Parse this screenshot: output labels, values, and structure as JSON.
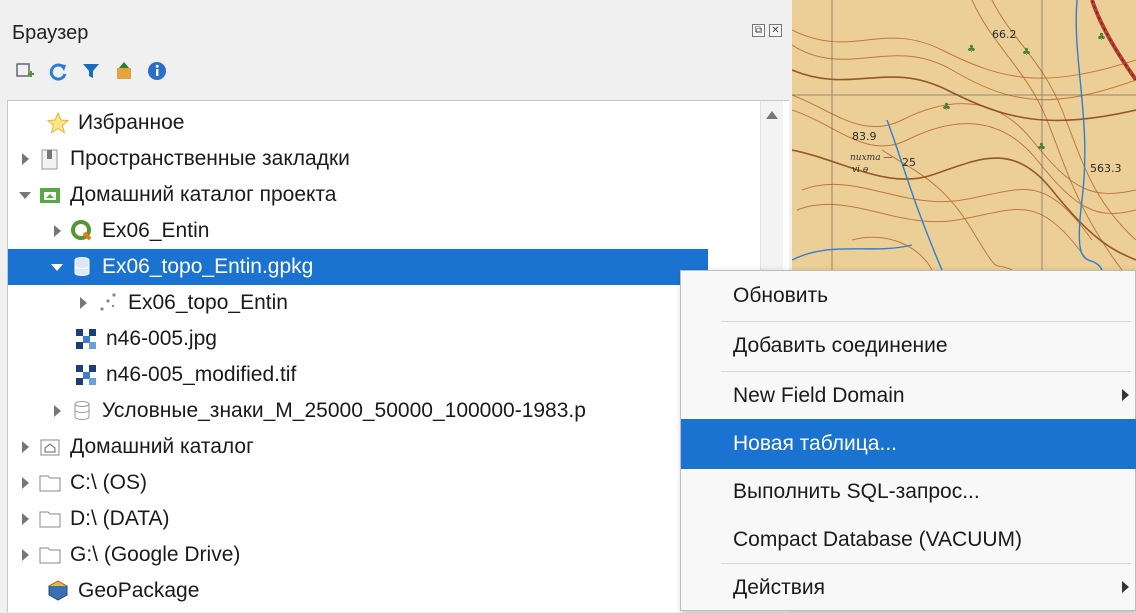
{
  "panel": {
    "title": "Браузер",
    "controls": [
      "⧉",
      "✕"
    ]
  },
  "tree": {
    "items": [
      {
        "label": "Избранное",
        "icon": "star-icon",
        "expander": "none"
      },
      {
        "label": "Пространственные закладки",
        "icon": "bookmarks-icon",
        "expander": "collapsed"
      },
      {
        "label": "Домашний каталог проекта",
        "icon": "project-home-icon",
        "expander": "expanded"
      },
      {
        "label": "Ex06_Entin",
        "icon": "qgis-project-icon",
        "expander": "collapsed"
      },
      {
        "label": "Ex06_topo_Entin.gpkg",
        "icon": "geopackage-icon",
        "expander": "expanded",
        "selected": true
      },
      {
        "label": "Ex06_topo_Entin",
        "icon": "point-layer-icon",
        "expander": "collapsed"
      },
      {
        "label": "n46-005.jpg",
        "icon": "raster-icon",
        "expander": "none"
      },
      {
        "label": "n46-005_modified.tif",
        "icon": "raster-icon",
        "expander": "none"
      },
      {
        "label": "Условные_знаки_М_25000_50000_100000-1983.p",
        "icon": "geopackage-icon",
        "expander": "collapsed"
      },
      {
        "label": "Домашний каталог",
        "icon": "home-folder-icon",
        "expander": "collapsed"
      },
      {
        "label": "C:\\ (OS)",
        "icon": "folder-icon",
        "expander": "collapsed"
      },
      {
        "label": "D:\\ (DATA)",
        "icon": "folder-icon",
        "expander": "collapsed"
      },
      {
        "label": "G:\\ (Google Drive)",
        "icon": "folder-icon",
        "expander": "collapsed"
      },
      {
        "label": "GeoPackage",
        "icon": "geopackage-provider-icon",
        "expander": "none"
      }
    ]
  },
  "map": {
    "labels": [
      "66.2",
      "83.9",
      "563.3",
      "25"
    ]
  },
  "context_menu": {
    "items": [
      {
        "label": "Обновить",
        "submenu": false
      },
      {
        "label": "Добавить соединение",
        "submenu": false
      },
      {
        "label": "New Field Domain",
        "submenu": true
      },
      {
        "label": "Новая таблица...",
        "submenu": false,
        "highlighted": true
      },
      {
        "label": "Выполнить SQL-запрос...",
        "submenu": false
      },
      {
        "label": "Compact Database (VACUUM)",
        "submenu": false
      },
      {
        "label": "Действия",
        "submenu": true
      }
    ]
  },
  "colors": {
    "selection": "#1a73d1",
    "map_background": "#e8c98e",
    "contour": "#b5651d",
    "water": "#2f7fd0"
  }
}
